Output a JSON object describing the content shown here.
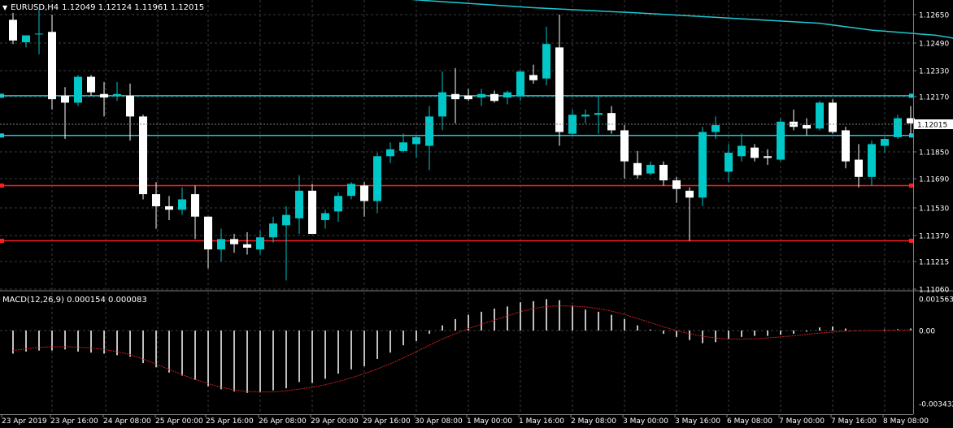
{
  "header": {
    "symbol_tf": "EURUSD,H4",
    "ohlc": "1.12049 1.12124 1.11961 1.12015"
  },
  "macd_label": "MACD(12,26,9) 0.000154 0.000083",
  "colors": {
    "background": "#000000",
    "grid": "#3c3c3c",
    "bull": "#00c8c8",
    "bear": "#ffffff",
    "ma": "#1ec8d2",
    "support": "#ff1e1e",
    "signal": "#c81e1e",
    "price_tag": "#ffffff"
  },
  "chart_data": [
    {
      "type": "candlestick",
      "title": "EURUSD,H4",
      "price_ticks": [
        "1.12650",
        "1.12490",
        "1.12330",
        "1.12170",
        "1.11850",
        "1.11690",
        "1.11530",
        "1.11370",
        "1.11215",
        "1.11060"
      ],
      "current_price": "1.12015",
      "time_ticks": [
        "23 Apr 2019",
        "23 Apr 16:00",
        "24 Apr 08:00",
        "25 Apr 00:00",
        "25 Apr 16:00",
        "26 Apr 08:00",
        "29 Apr 00:00",
        "29 Apr 16:00",
        "30 Apr 08:00",
        "1 May 00:00",
        "1 May 16:00",
        "2 May 08:00",
        "3 May 00:00",
        "3 May 16:00",
        "6 May 08:00",
        "7 May 00:00",
        "7 May 16:00",
        "8 May 08:00"
      ],
      "ylim": [
        1.1106,
        1.1276
      ],
      "horizontal_lines": [
        {
          "price": 1.1218,
          "color": "#1ec8d2"
        },
        {
          "price": 1.1195,
          "color": "#1ec8d2"
        },
        {
          "price": 1.1166,
          "color": "#ff1e1e"
        },
        {
          "price": 1.1134,
          "color": "#ff1e1e"
        }
      ],
      "moving_average": [
        [
          13,
          1.1289
        ],
        [
          22,
          1.1279
        ],
        [
          25,
          1.1277
        ],
        [
          32,
          1.1273
        ],
        [
          40,
          1.1269
        ],
        [
          48,
          1.1266
        ],
        [
          55,
          1.1263
        ],
        [
          62,
          1.126
        ],
        [
          66,
          1.1256
        ],
        [
          71,
          1.1253
        ],
        [
          75,
          1.1248
        ],
        [
          80,
          1.1244
        ],
        [
          84,
          1.1241
        ],
        [
          86,
          1.1237
        ]
      ],
      "candles": [
        {
          "o": 1.1262,
          "h": 1.1266,
          "l": 1.1248,
          "c": 1.125
        },
        {
          "o": 1.1249,
          "h": 1.1253,
          "l": 1.1246,
          "c": 1.1253
        },
        {
          "o": 1.1254,
          "h": 1.1268,
          "l": 1.1242,
          "c": 1.1254
        },
        {
          "o": 1.1255,
          "h": 1.1265,
          "l": 1.121,
          "c": 1.1216
        },
        {
          "o": 1.1218,
          "h": 1.1223,
          "l": 1.1193,
          "c": 1.1214
        },
        {
          "o": 1.1214,
          "h": 1.123,
          "l": 1.1212,
          "c": 1.1229
        },
        {
          "o": 1.1229,
          "h": 1.123,
          "l": 1.1218,
          "c": 1.122
        },
        {
          "o": 1.1219,
          "h": 1.1226,
          "l": 1.1206,
          "c": 1.1217
        },
        {
          "o": 1.1218,
          "h": 1.1226,
          "l": 1.1215,
          "c": 1.1219
        },
        {
          "o": 1.1218,
          "h": 1.1225,
          "l": 1.1192,
          "c": 1.1206
        },
        {
          "o": 1.1206,
          "h": 1.1207,
          "l": 1.1158,
          "c": 1.1161
        },
        {
          "o": 1.1161,
          "h": 1.1168,
          "l": 1.1141,
          "c": 1.1154
        },
        {
          "o": 1.1154,
          "h": 1.116,
          "l": 1.1146,
          "c": 1.1152
        },
        {
          "o": 1.1152,
          "h": 1.1165,
          "l": 1.1149,
          "c": 1.1158
        },
        {
          "o": 1.1161,
          "h": 1.1166,
          "l": 1.1135,
          "c": 1.1148
        },
        {
          "o": 1.1148,
          "h": 1.1148,
          "l": 1.1118,
          "c": 1.1129
        },
        {
          "o": 1.1129,
          "h": 1.1141,
          "l": 1.1122,
          "c": 1.1135
        },
        {
          "o": 1.1135,
          "h": 1.1138,
          "l": 1.1127,
          "c": 1.1132
        },
        {
          "o": 1.1132,
          "h": 1.1139,
          "l": 1.1126,
          "c": 1.113
        },
        {
          "o": 1.1129,
          "h": 1.114,
          "l": 1.1126,
          "c": 1.1136
        },
        {
          "o": 1.1136,
          "h": 1.1148,
          "l": 1.1133,
          "c": 1.1144
        },
        {
          "o": 1.1143,
          "h": 1.1154,
          "l": 1.1111,
          "c": 1.1149
        },
        {
          "o": 1.1147,
          "h": 1.1172,
          "l": 1.1138,
          "c": 1.1163
        },
        {
          "o": 1.1163,
          "h": 1.1167,
          "l": 1.1138,
          "c": 1.1138
        },
        {
          "o": 1.1146,
          "h": 1.1152,
          "l": 1.1141,
          "c": 1.115
        },
        {
          "o": 1.1151,
          "h": 1.1162,
          "l": 1.1145,
          "c": 1.116
        },
        {
          "o": 1.116,
          "h": 1.1168,
          "l": 1.1158,
          "c": 1.1167
        },
        {
          "o": 1.1166,
          "h": 1.1168,
          "l": 1.1148,
          "c": 1.1157
        },
        {
          "o": 1.1157,
          "h": 1.1185,
          "l": 1.115,
          "c": 1.1183
        },
        {
          "o": 1.1183,
          "h": 1.1191,
          "l": 1.1179,
          "c": 1.1187
        },
        {
          "o": 1.1186,
          "h": 1.1196,
          "l": 1.1185,
          "c": 1.1191
        },
        {
          "o": 1.119,
          "h": 1.1195,
          "l": 1.1182,
          "c": 1.1194
        },
        {
          "o": 1.1189,
          "h": 1.1212,
          "l": 1.1175,
          "c": 1.1206
        },
        {
          "o": 1.1206,
          "h": 1.1232,
          "l": 1.1198,
          "c": 1.122
        },
        {
          "o": 1.1219,
          "h": 1.1234,
          "l": 1.1202,
          "c": 1.1216
        },
        {
          "o": 1.1218,
          "h": 1.1222,
          "l": 1.1215,
          "c": 1.1216
        },
        {
          "o": 1.1217,
          "h": 1.1222,
          "l": 1.1212,
          "c": 1.1219
        },
        {
          "o": 1.1219,
          "h": 1.1221,
          "l": 1.1214,
          "c": 1.1215
        },
        {
          "o": 1.1217,
          "h": 1.1221,
          "l": 1.1213,
          "c": 1.122
        },
        {
          "o": 1.1218,
          "h": 1.1233,
          "l": 1.1215,
          "c": 1.1232
        },
        {
          "o": 1.123,
          "h": 1.1236,
          "l": 1.1225,
          "c": 1.1227
        },
        {
          "o": 1.1228,
          "h": 1.1258,
          "l": 1.1224,
          "c": 1.1248
        },
        {
          "o": 1.1246,
          "h": 1.1265,
          "l": 1.1189,
          "c": 1.1197
        },
        {
          "o": 1.1196,
          "h": 1.121,
          "l": 1.1195,
          "c": 1.1207
        },
        {
          "o": 1.1206,
          "h": 1.121,
          "l": 1.1202,
          "c": 1.1207
        },
        {
          "o": 1.1207,
          "h": 1.1218,
          "l": 1.1196,
          "c": 1.1208
        },
        {
          "o": 1.1208,
          "h": 1.1212,
          "l": 1.1196,
          "c": 1.1198
        },
        {
          "o": 1.1198,
          "h": 1.1201,
          "l": 1.117,
          "c": 1.118
        },
        {
          "o": 1.1179,
          "h": 1.1186,
          "l": 1.117,
          "c": 1.1172
        },
        {
          "o": 1.1173,
          "h": 1.118,
          "l": 1.1172,
          "c": 1.1178
        },
        {
          "o": 1.1178,
          "h": 1.118,
          "l": 1.1166,
          "c": 1.1169
        },
        {
          "o": 1.1169,
          "h": 1.1171,
          "l": 1.1156,
          "c": 1.1164
        },
        {
          "o": 1.1163,
          "h": 1.1165,
          "l": 1.1134,
          "c": 1.1159
        },
        {
          "o": 1.1159,
          "h": 1.12,
          "l": 1.1154,
          "c": 1.1197
        },
        {
          "o": 1.1197,
          "h": 1.1206,
          "l": 1.1193,
          "c": 1.1201
        },
        {
          "o": 1.1174,
          "h": 1.119,
          "l": 1.1168,
          "c": 1.1185
        },
        {
          "o": 1.1183,
          "h": 1.1196,
          "l": 1.118,
          "c": 1.1189
        },
        {
          "o": 1.1188,
          "h": 1.119,
          "l": 1.118,
          "c": 1.1182
        },
        {
          "o": 1.1183,
          "h": 1.1187,
          "l": 1.1178,
          "c": 1.1182
        },
        {
          "o": 1.1181,
          "h": 1.1205,
          "l": 1.118,
          "c": 1.1203
        },
        {
          "o": 1.1203,
          "h": 1.121,
          "l": 1.1198,
          "c": 1.12
        },
        {
          "o": 1.1201,
          "h": 1.1205,
          "l": 1.1195,
          "c": 1.1199
        },
        {
          "o": 1.1199,
          "h": 1.1215,
          "l": 1.1198,
          "c": 1.1214
        },
        {
          "o": 1.1214,
          "h": 1.1216,
          "l": 1.1196,
          "c": 1.1197
        },
        {
          "o": 1.1198,
          "h": 1.12,
          "l": 1.1176,
          "c": 1.118
        },
        {
          "o": 1.1181,
          "h": 1.119,
          "l": 1.1165,
          "c": 1.1171
        },
        {
          "o": 1.1171,
          "h": 1.1192,
          "l": 1.1166,
          "c": 1.119
        },
        {
          "o": 1.1189,
          "h": 1.1194,
          "l": 1.1185,
          "c": 1.1193
        },
        {
          "o": 1.1194,
          "h": 1.1207,
          "l": 1.1193,
          "c": 1.1205
        },
        {
          "o": 1.1205,
          "h": 1.1212,
          "l": 1.1196,
          "c": 1.1202
        }
      ]
    },
    {
      "type": "bar",
      "title": "MACD(12,26,9)",
      "ylim": [
        -0.003432,
        0.001563
      ],
      "y_ticks": [
        "0.001563",
        "0.00",
        "-0.003432"
      ],
      "main_values": [
        -0.00105,
        -0.00095,
        -0.0009,
        -0.0009,
        -0.00085,
        -0.00095,
        -0.001,
        -0.00105,
        -0.00112,
        -0.0012,
        -0.0015,
        -0.0017,
        -0.00195,
        -0.0021,
        -0.0023,
        -0.0026,
        -0.00275,
        -0.00285,
        -0.00292,
        -0.0029,
        -0.0028,
        -0.0027,
        -0.0024,
        -0.00245,
        -0.00225,
        -0.002,
        -0.0018,
        -0.00165,
        -0.0013,
        -0.001,
        -0.00065,
        -0.00045,
        -0.0001,
        0.0003,
        0.0006,
        0.0008,
        0.00095,
        0.0011,
        0.0012,
        0.0014,
        0.00145,
        0.00155,
        0.0015,
        0.00125,
        0.00105,
        0.00095,
        0.0008,
        0.0006,
        0.0003,
        0.0001,
        -0.0001,
        -0.00025,
        -0.0004,
        -0.00055,
        -0.0005,
        -0.00035,
        -0.00025,
        -0.0002,
        -0.0002,
        -0.00015,
        -0.0001,
        0.0,
        0.0002,
        0.00025,
        0.00015,
        5e-05,
        5e-05,
        0.0001,
        0.00012,
        0.00015
      ],
      "signal_values": [
        -0.0009,
        -0.00082,
        -0.00075,
        -0.00072,
        -0.00072,
        -0.00074,
        -0.00078,
        -0.00085,
        -0.00095,
        -0.0011,
        -0.0013,
        -0.00155,
        -0.0018,
        -0.00205,
        -0.00228,
        -0.00248,
        -0.00265,
        -0.00278,
        -0.00285,
        -0.00288,
        -0.00287,
        -0.00282,
        -0.00274,
        -0.00265,
        -0.00253,
        -0.00238,
        -0.0022,
        -0.002,
        -0.00178,
        -0.00153,
        -0.00125,
        -0.00095,
        -0.00065,
        -0.00035,
        -0.0001,
        0.00015,
        0.00035,
        0.00055,
        0.00075,
        0.00095,
        0.0011,
        0.0012,
        0.00123,
        0.00122,
        0.00118,
        0.0011,
        0.00098,
        0.00082,
        0.00063,
        0.00043,
        0.00023,
        5e-05,
        -0.0001,
        -0.00022,
        -0.0003,
        -0.00035,
        -0.00036,
        -0.00034,
        -0.0003,
        -0.00025,
        -0.0002,
        -0.00013,
        -7e-05,
        -2e-05,
        2e-05,
        4e-05,
        5e-05,
        6e-05,
        7e-05,
        8e-05
      ]
    }
  ]
}
